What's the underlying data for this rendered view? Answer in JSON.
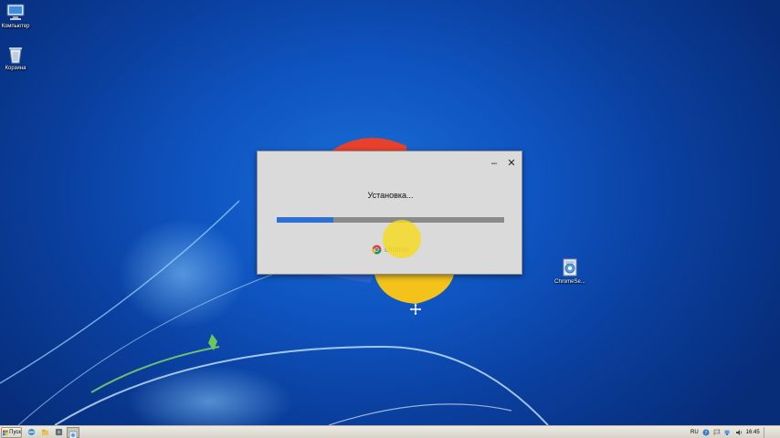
{
  "desktop": {
    "icons": [
      {
        "label": "Компьютер",
        "icon": "computer-icon"
      },
      {
        "label": "Корзина",
        "icon": "recycle-bin-icon"
      },
      {
        "label": "ChromeSe...",
        "icon": "chrome-setup-file-icon"
      }
    ]
  },
  "installer": {
    "minimize_label": "–",
    "close_label": "✕",
    "status": "Установка...",
    "progress_fraction": 0.25,
    "brand_label": "chrome",
    "brand_icon": "chrome-logo-icon"
  },
  "taskbar": {
    "start_label": "Пуск",
    "language": "RU",
    "clock": "16:45"
  },
  "colors": {
    "desktop_blue": "#0f55c2",
    "progress_blue": "#2d6fd4",
    "window_bg": "#dadada",
    "cursor_highlight": "#f5da1e"
  }
}
